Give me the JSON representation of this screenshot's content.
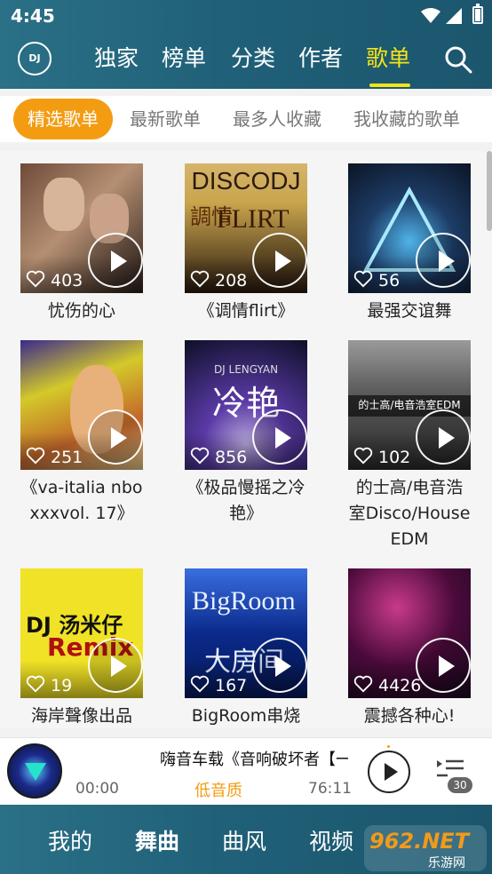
{
  "status": {
    "time": "4:45"
  },
  "header": {
    "logo": "DJ",
    "tabs": [
      "独家",
      "榜单",
      "分类",
      "作者",
      "歌单"
    ],
    "active_tab": 4,
    "search_icon": "search-icon"
  },
  "subtabs": {
    "items": [
      "精选歌单",
      "最新歌单",
      "最多人收藏",
      "我收藏的歌单"
    ],
    "active": 0
  },
  "playlists": [
    {
      "title": "忧伤的心",
      "likes": "403",
      "thumb_colors": [
        "#6e4a3a",
        "#b58f72",
        "#2a1f1a"
      ]
    },
    {
      "title": "《调情flirt》",
      "likes": "208",
      "thumb_colors": [
        "#c9a54d",
        "#2b1b10",
        "#d6b46b"
      ]
    },
    {
      "title": "最强交谊舞",
      "likes": "56",
      "thumb_colors": [
        "#1d3c66",
        "#4fb3e8",
        "#0b1424"
      ]
    },
    {
      "title": "《va-italia nboxxxvol. 17》",
      "likes": "251",
      "thumb_colors": [
        "#d4c92a",
        "#c2662a",
        "#3a2a8e"
      ]
    },
    {
      "title": "《极品慢摇之冷艳》",
      "likes": "856",
      "thumb_colors": [
        "#0d0f26",
        "#5b3aa8",
        "#b7a7d8"
      ]
    },
    {
      "title": "的士高/电音浩室Disco/HouseEDM",
      "likes": "102",
      "thumb_colors": [
        "#2b2b2b",
        "#9a9a9a",
        "#5b5b5b"
      ]
    },
    {
      "title": "海岸聲像出品",
      "likes": "19",
      "thumb_colors": [
        "#f0e226",
        "#e8d820",
        "#b01010"
      ]
    },
    {
      "title": "BigRoom串烧",
      "likes": "167",
      "thumb_colors": [
        "#0a2a8a",
        "#3a6ee0",
        "#061a5a"
      ]
    },
    {
      "title": "震撼各种心!",
      "likes": "4426",
      "thumb_colors": [
        "#4a0a3a",
        "#c83a8a",
        "#1a0a20"
      ]
    }
  ],
  "thumb_texts": {
    "p1": "DISCODJ",
    "p1b": "FLIRT",
    "p1c": "調情",
    "p4": "冷艳",
    "p4b": "DJ LENGYAN",
    "p5": "的士高/电音浩室EDM",
    "p6": "DJ 汤米仔",
    "p6b": "Remix",
    "p7": "BigRoom",
    "p7b": "大房间"
  },
  "player": {
    "title": "嗨音车载《音响破坏者【一",
    "current_time": "00:00",
    "quality": "低音质",
    "total_time": "76:11",
    "queue_count": "30"
  },
  "bottom_nav": {
    "items": [
      "我的",
      "舞曲",
      "曲风",
      "视频"
    ],
    "active": 1
  },
  "watermark": {
    "main": "962.NET",
    "sub": "乐游网"
  }
}
